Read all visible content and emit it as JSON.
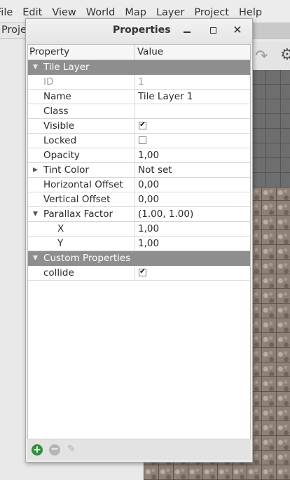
{
  "menubar": {
    "items": [
      "File",
      "Edit",
      "View",
      "World",
      "Map",
      "Layer",
      "Project",
      "Help"
    ]
  },
  "tabstrip": {
    "left_tab": "Project"
  },
  "dialog": {
    "title": "Properties",
    "columns": {
      "property": "Property",
      "value": "Value"
    },
    "sections": {
      "tile_layer": "Tile Layer",
      "custom": "Custom Properties"
    },
    "rows": {
      "id": {
        "label": "ID",
        "value": "1"
      },
      "name": {
        "label": "Name",
        "value": "Tile Layer 1"
      },
      "class": {
        "label": "Class",
        "value": ""
      },
      "visible": {
        "label": "Visible",
        "checked": true
      },
      "locked": {
        "label": "Locked",
        "checked": false
      },
      "opacity": {
        "label": "Opacity",
        "value": "1,00"
      },
      "tint_color": {
        "label": "Tint Color",
        "value": "Not set"
      },
      "horizontal_offset": {
        "label": "Horizontal Offset",
        "value": "0,00"
      },
      "vertical_offset": {
        "label": "Vertical Offset",
        "value": "0,00"
      },
      "parallax_factor": {
        "label": "Parallax Factor",
        "value": "(1.00, 1.00)"
      },
      "parallax_x": {
        "label": "X",
        "value": "1,00"
      },
      "parallax_y": {
        "label": "Y",
        "value": "1,00"
      },
      "collide": {
        "label": "collide",
        "checked": true
      }
    },
    "icons": {
      "add": "plus-circle-icon",
      "remove": "minus-circle-icon",
      "edit": "pencil-icon"
    }
  },
  "colors": {
    "group_header": "#8e8e8e",
    "add_button": "#2f8f3a"
  }
}
